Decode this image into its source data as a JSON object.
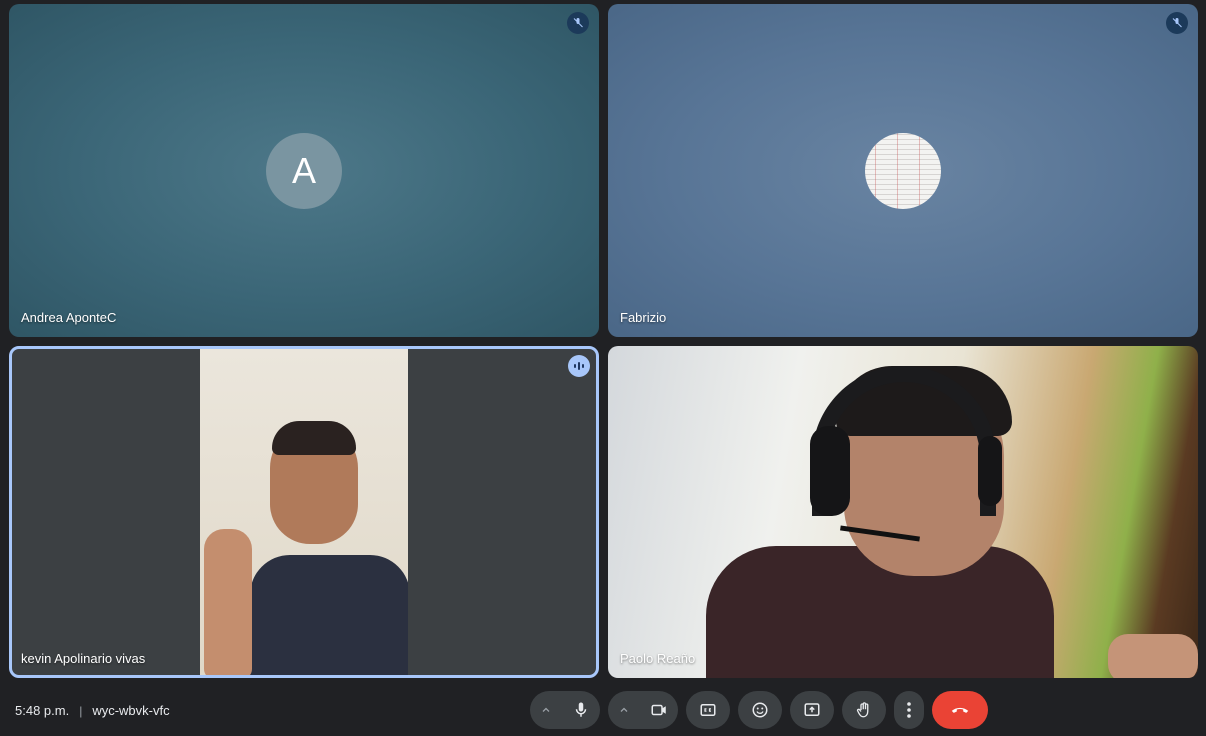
{
  "participants": [
    {
      "name": "Andrea AponteC",
      "avatar_letter": "A",
      "status_icon": "mic-off-icon"
    },
    {
      "name": "Fabrizio",
      "status_icon": "mic-off-icon"
    },
    {
      "name": "kevin Apolinario vivas",
      "status_icon": "speaking-indicator-icon",
      "active_speaker": true
    },
    {
      "name": "Paolo Reaño"
    }
  ],
  "meeting": {
    "time": "5:48 p.m.",
    "separator": "|",
    "code": "wyc-wbvk-vfc"
  },
  "controls": [
    {
      "id": "mic",
      "icon": "microphone-icon",
      "has_options": true
    },
    {
      "id": "camera",
      "icon": "videocam-icon",
      "has_options": true
    },
    {
      "id": "captions",
      "icon": "closed-captions-icon"
    },
    {
      "id": "reactions",
      "icon": "emoji-icon"
    },
    {
      "id": "present",
      "icon": "present-screen-icon"
    },
    {
      "id": "raise-hand",
      "icon": "hand-icon"
    },
    {
      "id": "more",
      "icon": "more-vert-icon"
    },
    {
      "id": "leave",
      "icon": "call-end-icon"
    }
  ],
  "colors": {
    "background": "#202124",
    "active_border": "#a8c7fa",
    "hangup": "#ea4335",
    "control": "#3c4043"
  }
}
